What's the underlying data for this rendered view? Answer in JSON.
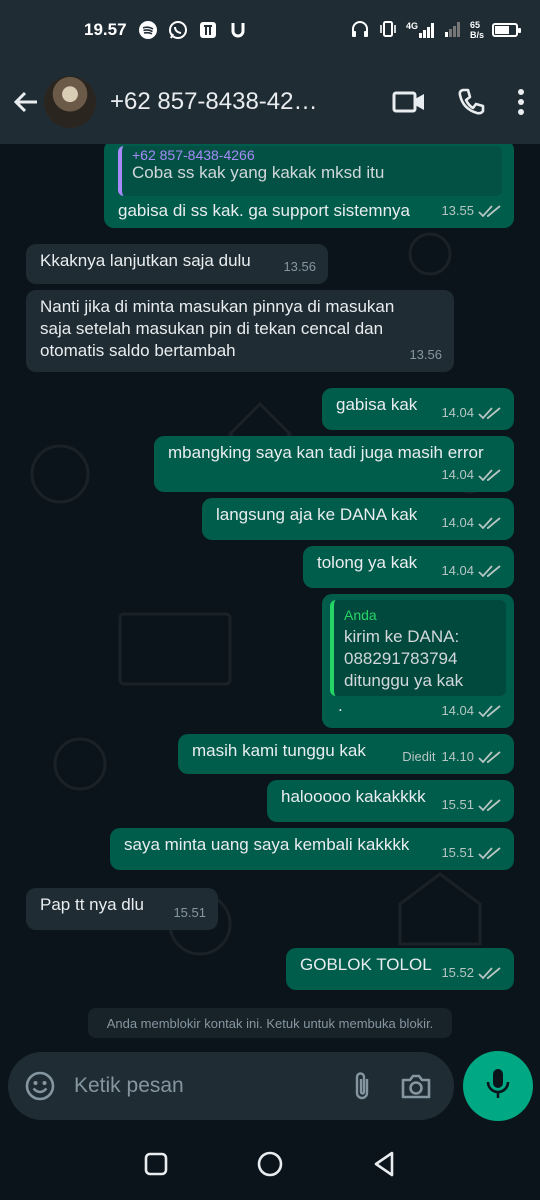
{
  "status_bar": {
    "time": "19.57",
    "network_label": "4G",
    "speed_value": "65",
    "speed_unit": "B/s"
  },
  "header": {
    "contact": "+62 857-8438-42…",
    "icons": [
      "back-arrow-icon",
      "video-call-icon",
      "phone-icon",
      "more-vert-icon"
    ]
  },
  "messages": [
    {
      "dir": "out",
      "quote_name": "+62 857-8438-4266",
      "quote_text": "Coba ss kak yang kakak mksd itu",
      "text": "gabisa di ss kak. ga support sistemnya",
      "time": "13.55"
    },
    {
      "dir": "in",
      "text": "Kkaknya lanjutkan saja dulu",
      "time": "13.56"
    },
    {
      "dir": "in",
      "text": "Nanti jika di minta masukan pinnya di masukan saja setelah masukan pin di tekan cencal dan otomatis saldo bertambah",
      "time": "13.56"
    },
    {
      "dir": "out",
      "text": "gabisa kak",
      "time": "14.04"
    },
    {
      "dir": "out",
      "text": "mbangking saya kan tadi juga masih error",
      "time": "14.04"
    },
    {
      "dir": "out",
      "text": "langsung aja ke DANA kak",
      "time": "14.04"
    },
    {
      "dir": "out",
      "text": "tolong ya kak",
      "time": "14.04"
    },
    {
      "dir": "out",
      "quote_name": "Anda",
      "quote_text": "kirim ke DANA: 088291783794 ditunggu ya kak",
      "text": ".",
      "time": "14.04"
    },
    {
      "dir": "out",
      "text": "masih kami tunggu kak",
      "edited": "Diedit",
      "time": "14.10"
    },
    {
      "dir": "out",
      "text": "halooooo kakakkkk",
      "time": "15.51"
    },
    {
      "dir": "out",
      "text": "saya minta uang saya kembali kakkkk",
      "time": "15.51"
    },
    {
      "dir": "in",
      "text": "Pap tt nya dlu",
      "time": "15.51"
    },
    {
      "dir": "out",
      "text": "GOBLOK TOLOL",
      "time": "15.52"
    }
  ],
  "notice": "Anda memblokir kontak ini. Ketuk untuk membuka blokir.",
  "input": {
    "placeholder": "Ketik pesan",
    "icons": [
      "emoji-icon",
      "attach-icon",
      "camera-icon",
      "mic-icon"
    ]
  },
  "navbar": {
    "icons": [
      "recents-icon",
      "home-icon",
      "back-icon"
    ]
  },
  "colors": {
    "outgoing": "#005c4b",
    "incoming": "#1f2c34",
    "accent": "#00a884",
    "background": "#0b141a"
  }
}
